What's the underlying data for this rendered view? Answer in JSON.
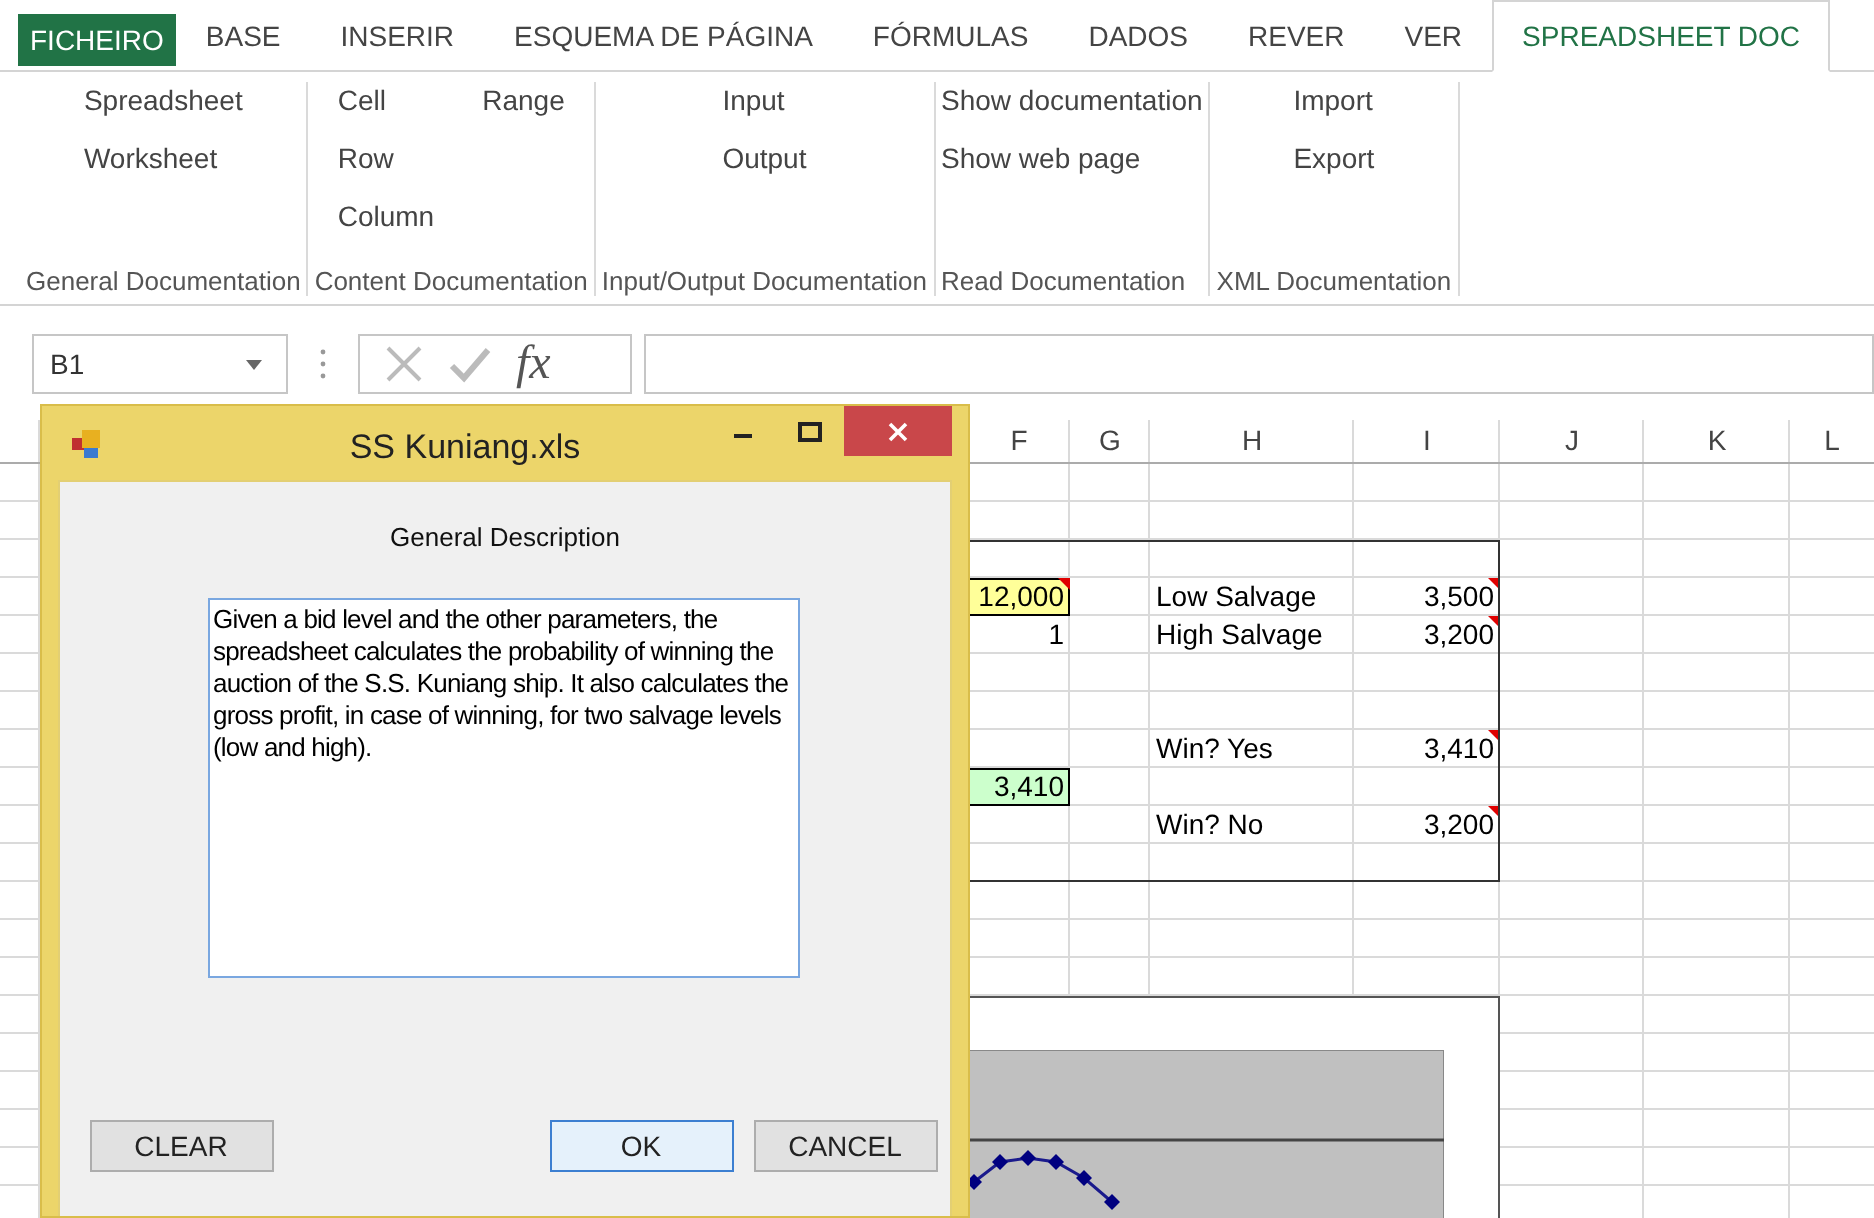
{
  "ribbon": {
    "tabs": [
      {
        "label": "FICHEIRO",
        "kind": "file",
        "selected": false
      },
      {
        "label": "BASE",
        "kind": "tab",
        "selected": false
      },
      {
        "label": "INSERIR",
        "kind": "tab",
        "selected": false
      },
      {
        "label": "ESQUEMA DE PÁGINA",
        "kind": "tab",
        "selected": false
      },
      {
        "label": "FÓRMULAS",
        "kind": "tab",
        "selected": false
      },
      {
        "label": "DADOS",
        "kind": "tab",
        "selected": false
      },
      {
        "label": "REVER",
        "kind": "tab",
        "selected": false
      },
      {
        "label": "VER",
        "kind": "tab",
        "selected": false
      },
      {
        "label": "SPREADSHEET DOC",
        "kind": "tab",
        "selected": true
      }
    ],
    "groups": [
      {
        "label": "General Documentation",
        "columns": [
          [
            "Spreadsheet",
            "Worksheet"
          ]
        ]
      },
      {
        "label": "Content Documentation",
        "columns": [
          [
            "Cell",
            "Row",
            "Column"
          ],
          [
            "Range"
          ]
        ]
      },
      {
        "label": "Input/Output Documentation",
        "columns": [
          [
            "Input",
            "Output"
          ]
        ]
      },
      {
        "label": "Read Documentation",
        "columns": [
          [
            "Show documentation",
            "Show web page"
          ]
        ]
      },
      {
        "label": "XML Documentation",
        "columns": [
          [
            "Import",
            "Export"
          ]
        ]
      }
    ]
  },
  "formula_bar": {
    "name_box": "B1",
    "function_button": "fx"
  },
  "sheet": {
    "column_headers": [
      "F",
      "G",
      "H",
      "I",
      "J",
      "K",
      "L"
    ],
    "rows": [
      {
        "kind": "blank"
      },
      {
        "kind": "blank"
      },
      {
        "kind": "blank"
      },
      {
        "kind": "data",
        "cells": [
          {
            "kind": "number",
            "text": "12,000",
            "color": "#ffff99",
            "comment": true
          },
          {
            "kind": "empty"
          },
          {
            "kind": "label",
            "text": "Low Salvage",
            "comment": false
          },
          {
            "kind": "number",
            "text": "3,500",
            "comment": true
          }
        ]
      },
      {
        "kind": "data",
        "cells": [
          {
            "kind": "number",
            "text": "1",
            "comment": false
          },
          {
            "kind": "empty"
          },
          {
            "kind": "label",
            "text": "High Salvage",
            "comment": false
          },
          {
            "kind": "number",
            "text": "3,200",
            "comment": true
          }
        ]
      },
      {
        "kind": "blank"
      },
      {
        "kind": "blank"
      },
      {
        "kind": "data",
        "cells": [
          {
            "kind": "empty"
          },
          {
            "kind": "empty"
          },
          {
            "kind": "label",
            "text": "Win? Yes",
            "comment": false
          },
          {
            "kind": "number",
            "text": "3,410",
            "comment": true
          }
        ]
      },
      {
        "kind": "data",
        "cells": [
          {
            "kind": "number",
            "text": "3,410",
            "color": "#ccffcc",
            "comment": false
          }
        ]
      },
      {
        "kind": "data",
        "cells": [
          {
            "kind": "empty"
          },
          {
            "kind": "empty"
          },
          {
            "kind": "label",
            "text": "Win? No",
            "comment": false
          },
          {
            "kind": "number",
            "text": "3,200",
            "comment": true
          }
        ]
      }
    ]
  },
  "dialog": {
    "title": "SS Kuniang.xls",
    "heading": "General Description",
    "description": "Given a bid level and the other parameters, the spreadsheet calculates the probability of winning the auction of the S.S. Kuniang ship. It also calculates the gross profit, in case of winning, for two salvage levels (low and high).",
    "buttons": [
      {
        "label": "CLEAR",
        "default": false
      },
      {
        "label": "OK",
        "default": true
      },
      {
        "label": "CANCEL",
        "default": false
      }
    ]
  }
}
